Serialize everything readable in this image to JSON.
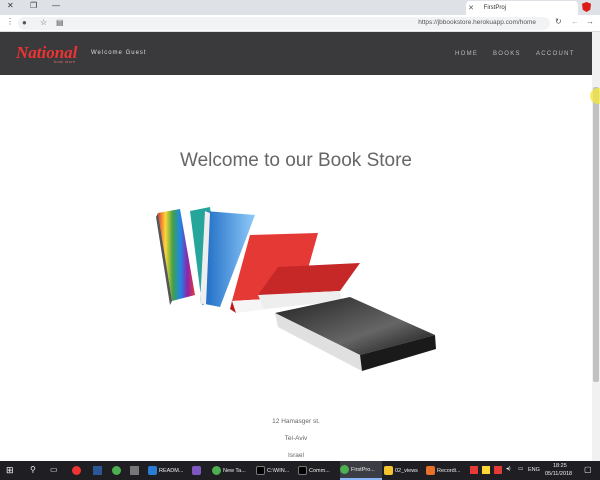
{
  "browser": {
    "tab_title": "FirstProj",
    "url": "https://jbbookstore.herokuapp.com/home"
  },
  "site": {
    "logo_text": "National",
    "logo_sub": "book store",
    "welcome": "Welcome Guest",
    "nav": [
      "HOME",
      "BOOKS",
      "ACCOUNT"
    ],
    "title": "Welcome to our Book Store",
    "address": [
      "12 Hamasger st.",
      "Tel-Aviv",
      "Israel"
    ]
  },
  "taskbar": {
    "items": [
      {
        "label": "READM...",
        "color": "#2b7cd3"
      },
      {
        "label": "",
        "color": "#7e57c2"
      },
      {
        "label": "New Ta...",
        "color": "#4caf50"
      },
      {
        "label": "C:\\WIN...",
        "color": "#111"
      },
      {
        "label": "Comm...",
        "color": "#111"
      },
      {
        "label": "FirstPro...",
        "color": "#4caf50"
      },
      {
        "label": "02_views",
        "color": "#f4c430"
      },
      {
        "label": "Recordi...",
        "color": "#e8702a"
      }
    ],
    "lang": "ENG",
    "time": "18:25",
    "date": "05/11/2018"
  }
}
